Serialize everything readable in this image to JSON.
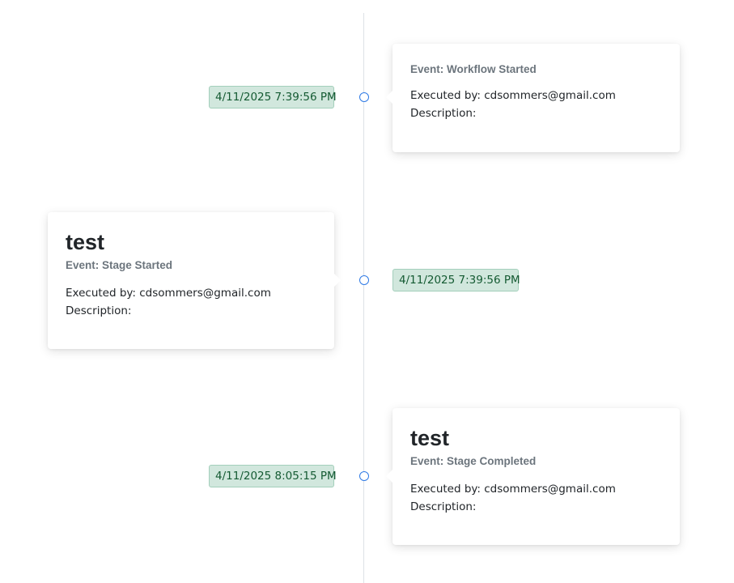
{
  "timeline": {
    "events": [
      {
        "side": "right",
        "title": "",
        "event_label": "Event: Workflow Started",
        "executed_by": "Executed by: cdsommers@gmail.com",
        "description": "Description:",
        "timestamp": "4/11/2025 7:39:56 PM"
      },
      {
        "side": "left",
        "title": "test",
        "event_label": "Event: Stage Started",
        "executed_by": "Executed by: cdsommers@gmail.com",
        "description": "Description:",
        "timestamp": "4/11/2025 7:39:56 PM"
      },
      {
        "side": "right",
        "title": "test",
        "event_label": "Event: Stage Completed",
        "executed_by": "Executed by: cdsommers@gmail.com",
        "description": "Description:",
        "timestamp": "4/11/2025 8:05:15 PM"
      }
    ]
  },
  "colors": {
    "line": "#dee2e6",
    "dot_border": "#2f7ae5",
    "badge_bg": "#d1e7dd",
    "badge_border": "#a3cfbb",
    "badge_text": "#145a32",
    "muted_text": "#6c757d"
  }
}
